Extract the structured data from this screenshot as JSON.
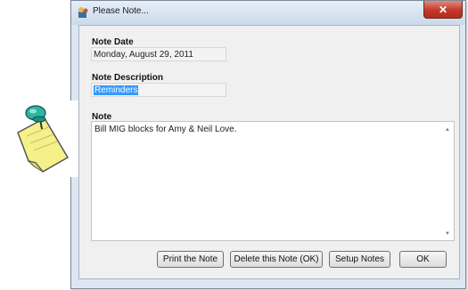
{
  "window": {
    "title": "Please Note..."
  },
  "fields": {
    "note_date_label": "Note Date",
    "note_date_value": "Monday, August 29, 2011",
    "note_description_label": "Note Description",
    "note_description_value": "Reminders",
    "note_label": "Note",
    "note_text": "Bill MIG blocks for Amy & Neil Love."
  },
  "buttons": {
    "print": "Print the Note",
    "delete": "Delete this Note (OK)",
    "setup": "Setup Notes",
    "ok": "OK"
  },
  "icons": {
    "app": "app-icon",
    "close": "close-icon",
    "pinned_note": "pinned-note-icon"
  },
  "colors": {
    "selection": "#3399ff",
    "close_button": "#c0392b",
    "dialog_bg": "#f0f0f0"
  }
}
